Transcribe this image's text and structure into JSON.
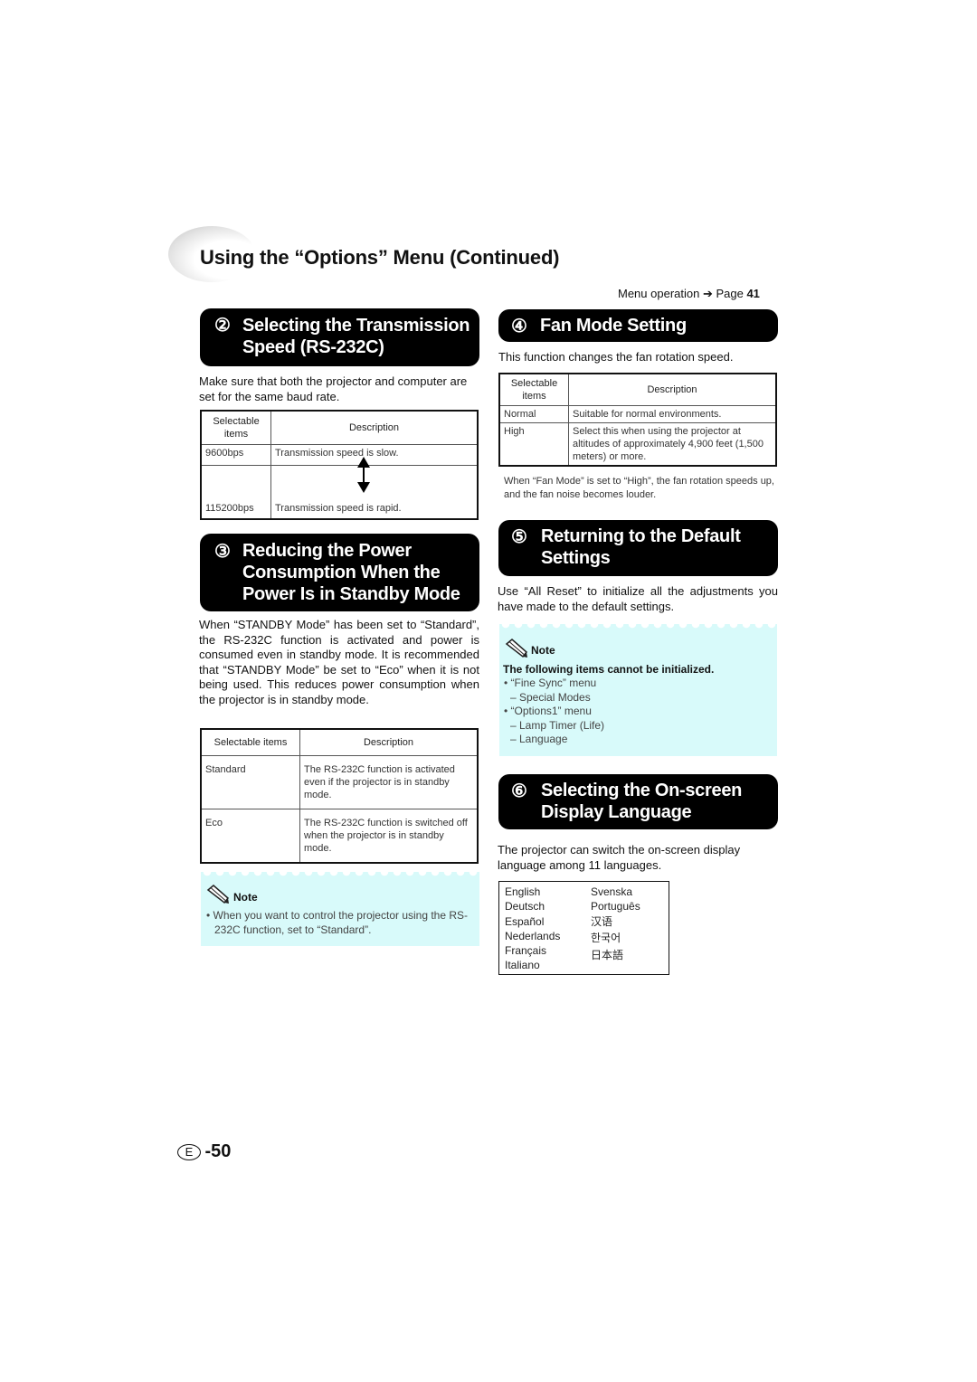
{
  "header": {
    "title": "Using the “Options” Menu (Continued)",
    "menu_operation_label": "Menu operation ➔ Page",
    "menu_operation_page": "41"
  },
  "sections": {
    "s2": {
      "number": "②",
      "title_line1": "Selecting the Transmission",
      "title_line2": "Speed (RS-232C)",
      "intro": "Make sure that both the projector and computer are set for the same baud rate.",
      "table": {
        "headers": [
          "Selectable items",
          "Description"
        ],
        "rows": [
          {
            "item": "9600bps",
            "description": "Transmission speed is slow."
          },
          {
            "item": "115200bps",
            "description": "Transmission speed is rapid."
          }
        ],
        "arrow_icon": "up-down-arrow-icon"
      }
    },
    "s3": {
      "number": "③",
      "title_line1": "Reducing the Power",
      "title_line2": "Consumption When the",
      "title_line3": "Power Is in Standby Mode",
      "body": "When “STANDBY Mode” has been set to “Standard”, the RS-232C function is activated and power is consumed even in standby mode. It is recommended that “STANDBY Mode” be set to “Eco” when it is not being used. This reduces power consumption when the projector is in standby mode.",
      "table": {
        "headers": [
          "Selectable items",
          "Description"
        ],
        "rows": [
          {
            "item": "Standard",
            "description": "The RS-232C function is activated even if the projector is in standby mode."
          },
          {
            "item": "Eco",
            "description": "The RS-232C function is switched off when the projector is in standby mode."
          }
        ]
      },
      "note": {
        "label": "Note",
        "icon": "pencil-icon",
        "bullet": "When you want to control the projector using the RS-232C function, set to “Standard”."
      }
    },
    "s4": {
      "number": "④",
      "title": "Fan Mode Setting",
      "intro": "This function changes the fan rotation speed.",
      "table": {
        "headers": [
          "Selectable items",
          "Description"
        ],
        "rows": [
          {
            "item": "Normal",
            "description": "Suitable for normal environments."
          },
          {
            "item": "High",
            "description": "Select this when using the projector at altitudes of approximately 4,900 feet (1,500 meters) or more."
          }
        ]
      },
      "after_note": "When “Fan Mode” is set to “High”, the fan rotation speeds up, and the fan noise becomes louder."
    },
    "s5": {
      "number": "⑤",
      "title_line1": "Returning to the Default",
      "title_line2": "Settings",
      "body": "Use “All Reset” to initialize all the adjustments you have made to the default settings.",
      "note": {
        "label": "Note",
        "icon": "pencil-icon",
        "heading": "The following items cannot be initialized.",
        "items": [
          "• “Fine Sync” menu",
          "– Special Modes",
          "• “Options1” menu",
          "– Lamp Timer (Life)",
          "– Language"
        ]
      }
    },
    "s6": {
      "number": "⑥",
      "title_line1": "Selecting the On-screen",
      "title_line2": "Display Language",
      "body": "The projector can switch the on-screen display language among 11 languages.",
      "languages_col1": [
        "English",
        "Deutsch",
        "Español",
        "Nederlands",
        "Français",
        "Italiano"
      ],
      "languages_col2": [
        "Svenska",
        "Português",
        "汉语",
        "한국어",
        "日本語"
      ]
    }
  },
  "footer": {
    "language_badge": "E",
    "page_number": "-50"
  }
}
